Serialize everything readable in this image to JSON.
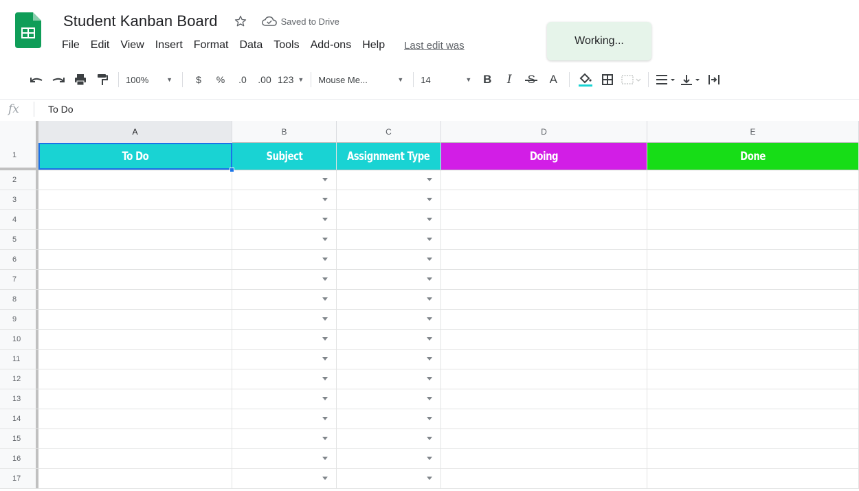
{
  "header": {
    "doc_title": "Student Kanban Board",
    "saved_status": "Saved to Drive",
    "toast": "Working...",
    "last_edit": "Last edit was",
    "menu": [
      {
        "label": "File"
      },
      {
        "label": "Edit"
      },
      {
        "label": "View"
      },
      {
        "label": "Insert"
      },
      {
        "label": "Format"
      },
      {
        "label": "Data"
      },
      {
        "label": "Tools"
      },
      {
        "label": "Add-ons"
      },
      {
        "label": "Help"
      }
    ]
  },
  "toolbar": {
    "zoom": "100%",
    "currency": "$",
    "percent": "%",
    "decimal_decrease": ".0",
    "decimal_increase": ".00",
    "more_formats": "123",
    "font": "Mouse Me...",
    "font_size": "14",
    "bold": "B",
    "italic": "I",
    "strike": "S",
    "text_color": "A"
  },
  "formula_bar": {
    "fx_label": "fx",
    "value": "To Do"
  },
  "grid": {
    "columns": [
      {
        "letter": "A"
      },
      {
        "letter": "B"
      },
      {
        "letter": "C"
      },
      {
        "letter": "D"
      },
      {
        "letter": "E"
      }
    ],
    "header_row": {
      "number": "1",
      "cells": [
        {
          "text": "To Do",
          "color": "#19d3d3"
        },
        {
          "text": "Subject",
          "color": "#19d3d3"
        },
        {
          "text": "Assignment Type",
          "color": "#19d3d3"
        },
        {
          "text": "Doing",
          "color": "#d21ee6"
        },
        {
          "text": "Done",
          "color": "#17dd17"
        }
      ]
    },
    "row_numbers": [
      "2",
      "3",
      "4",
      "5",
      "6",
      "7",
      "8",
      "9",
      "10",
      "11",
      "12",
      "13",
      "14",
      "15",
      "16",
      "17"
    ]
  },
  "colors": {
    "sheets_green": "#0f9d58",
    "selection_blue": "#1a73e8",
    "toast_bg": "#e6f4ea",
    "fill_underline": "#19d3d3"
  }
}
